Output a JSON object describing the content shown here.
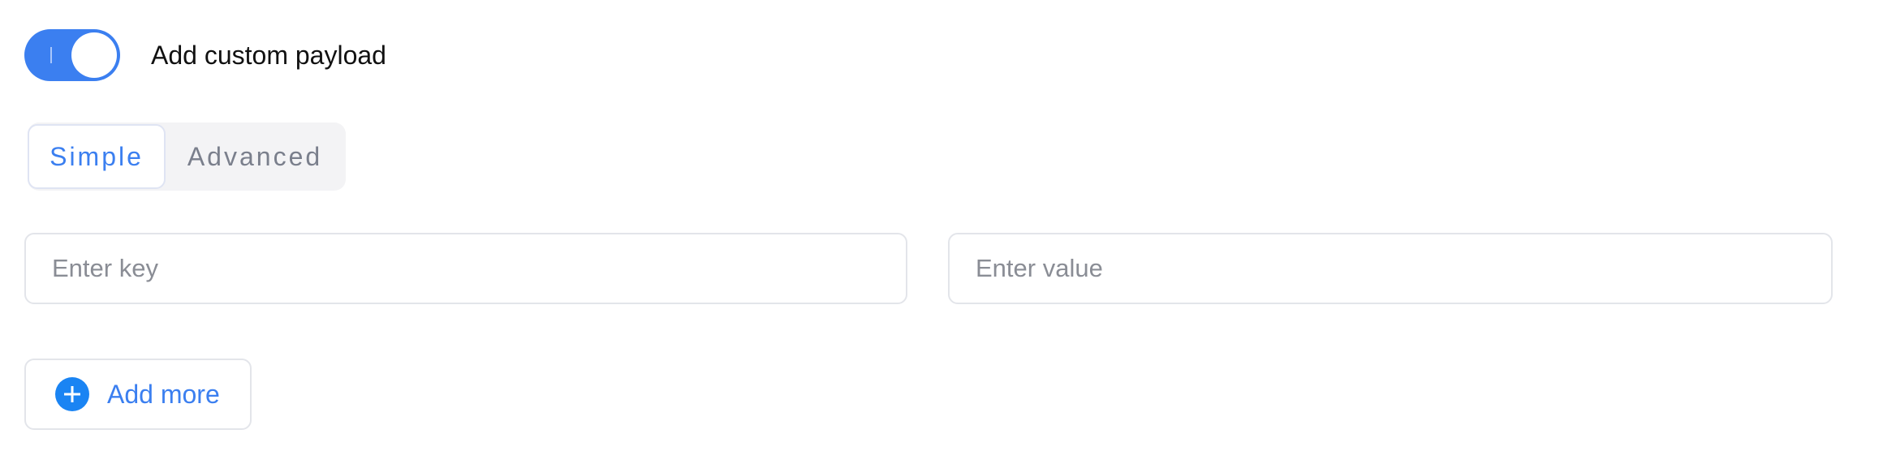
{
  "payload_toggle": {
    "label": "Add custom payload",
    "enabled": true,
    "on_color": "#3b7ff0"
  },
  "mode_tabs": {
    "items": [
      {
        "label": "Simple",
        "selected": true
      },
      {
        "label": "Advanced",
        "selected": false
      }
    ],
    "active_color": "#3b7ff0"
  },
  "key_field": {
    "placeholder": "Enter key",
    "value": ""
  },
  "value_field": {
    "placeholder": "Enter value",
    "value": ""
  },
  "add_more": {
    "label": "Add more",
    "icon": "plus-circle-icon",
    "icon_color": "#1a84f3"
  }
}
